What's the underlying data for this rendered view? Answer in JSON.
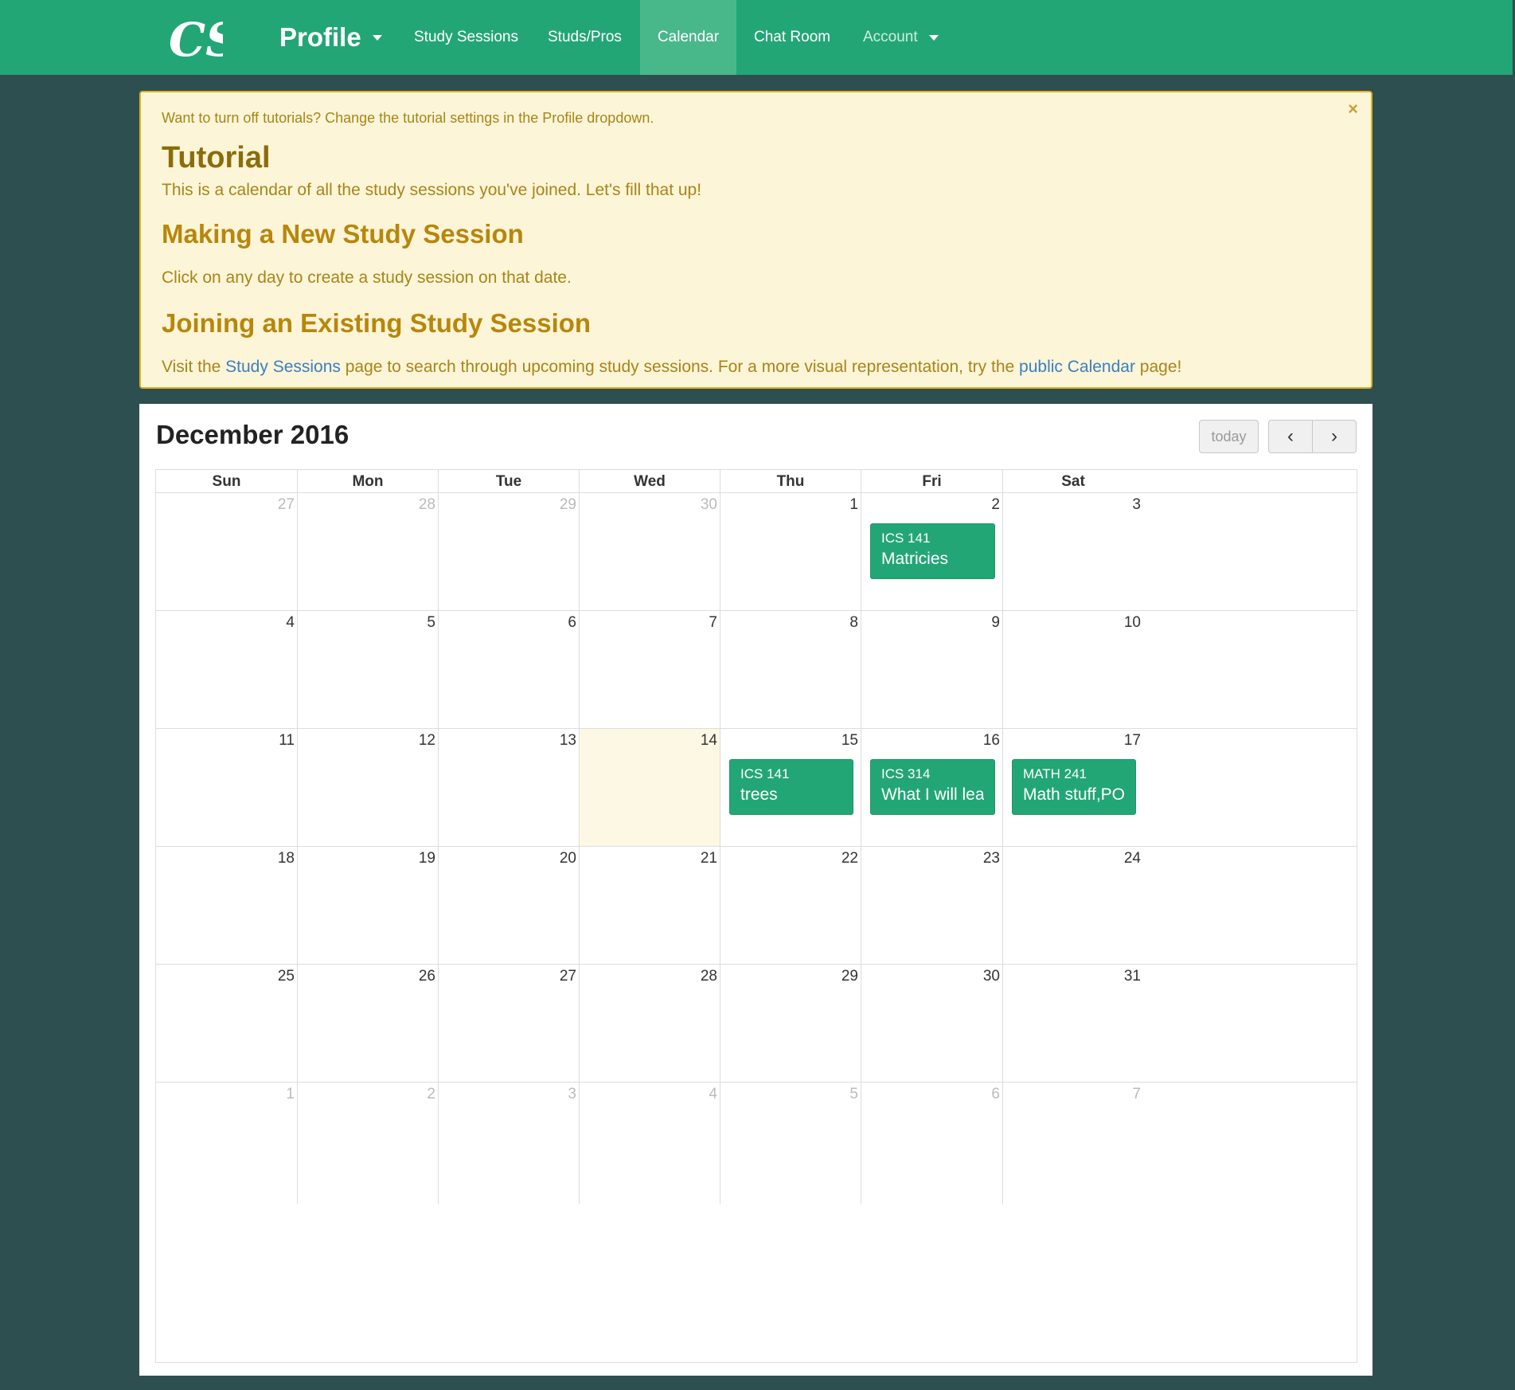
{
  "nav": {
    "logo": "CS",
    "brand": "Profile",
    "items": [
      {
        "label": "Study Sessions"
      },
      {
        "label": "Studs/Pros"
      },
      {
        "label": "Calendar"
      },
      {
        "label": "Chat Room"
      },
      {
        "label": "Account"
      }
    ]
  },
  "alert": {
    "close": "×",
    "hint": "Want to turn off tutorials? Change the tutorial settings in the Profile dropdown.",
    "title": "Tutorial",
    "intro": "This is a calendar of all the study sessions you've joined. Let's fill that up!",
    "new_heading": "Making a New Study Session",
    "new_text": "Click on any day to create a study session on that date.",
    "join_heading": "Joining an Existing Study Session",
    "join_pre": "Visit the ",
    "join_link1": "Study Sessions",
    "join_mid": " page to search through upcoming study sessions. For a more visual representation, try the ",
    "join_link2": "public Calendar",
    "join_post": " page!"
  },
  "calendar": {
    "title": "December 2016",
    "today_label": "today",
    "prev_label": "‹",
    "next_label": "›",
    "weekdays": [
      "Sun",
      "Mon",
      "Tue",
      "Wed",
      "Thu",
      "Fri",
      "Sat"
    ],
    "weeks": [
      [
        "27",
        "28",
        "29",
        "30",
        "1",
        "2",
        "3"
      ],
      [
        "4",
        "5",
        "6",
        "7",
        "8",
        "9",
        "10"
      ],
      [
        "11",
        "12",
        "13",
        "14",
        "15",
        "16",
        "17"
      ],
      [
        "18",
        "19",
        "20",
        "21",
        "22",
        "23",
        "24"
      ],
      [
        "25",
        "26",
        "27",
        "28",
        "29",
        "30",
        "31"
      ],
      [
        "1",
        "2",
        "3",
        "4",
        "5",
        "6",
        "7"
      ]
    ],
    "events": [
      {
        "date": "2",
        "course": "ICS 141",
        "title": "Matricies"
      },
      {
        "date": "15",
        "course": "ICS 141",
        "title": "trees"
      },
      {
        "date": "16",
        "course": "ICS 314",
        "title": "What I will learn v"
      },
      {
        "date": "17",
        "course": "MATH 241",
        "title": "Math stuff,POG^:"
      }
    ]
  }
}
